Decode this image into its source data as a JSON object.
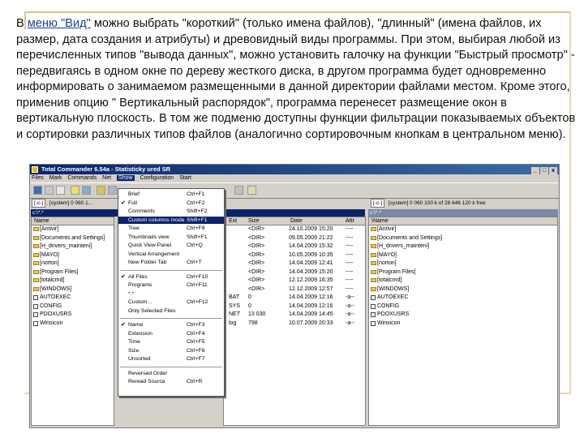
{
  "paragraph": {
    "lead": "В ",
    "link": "меню \"Вид\"",
    "rest": " можно выбрать \"короткий\" (только имена файлов), \"длинный\" (имена файлов, их размер, дата создания и атрибуты) и древовидный виды программы. При этом, выбирая любой из перечисленных типов \"вывода данных\", можно установить галочку на функции \"Быстрый просмотр\" - передвигаясь в одном окне по дереву жесткого диска, в другом программа будет одновременно информировать о занимаемом размещенными в данной директории файлами местом. Кроме этого, применив опцию \" Вертикальный распорядок\", программа перенесет размещение окон в вертикальную плоскость. В том же подменю доступны функции фильтрации показываемых объектов и сортировки различных типов файлов (аналогично сортировочным кнопкам в центральном меню)."
  },
  "window": {
    "title": "Total Commander 6.54a - Statisticky ured SR",
    "buttons": [
      "_",
      "□",
      "x"
    ]
  },
  "menubar": [
    "Files",
    "Mark",
    "Commands",
    "Net",
    "Show",
    "Configuration",
    "Start"
  ],
  "active_menu_index": 4,
  "left_drive": {
    "drive": "[-c-]",
    "volume": "[system]",
    "free": "0 060 1..."
  },
  "right_drive": {
    "drive": "[-c-]",
    "volume": "[system]",
    "free": "0 060 100 k of 28 646 120 k free"
  },
  "left_path": "c:\\*.*",
  "right_path": "c:\\*.*",
  "left_headers": {
    "name": "Name"
  },
  "mid_headers": {
    "ext": "Ext",
    "size": "Size",
    "date": "Date",
    "attr": "Attr"
  },
  "right_headers": {
    "name": "\\Name"
  },
  "left_files": [
    {
      "name": "[Antivir]",
      "folder": true
    },
    {
      "name": "[Documents and Settings]",
      "folder": true
    },
    {
      "name": "[H_drivers_mainteni]",
      "folder": true
    },
    {
      "name": "[MAYO]",
      "folder": true
    },
    {
      "name": "[norton]",
      "folder": true
    },
    {
      "name": "[Program Files]",
      "folder": true
    },
    {
      "name": "[totalcmd]",
      "folder": true
    },
    {
      "name": "[WINDOWS]",
      "folder": true
    },
    {
      "name": "AUTOEXEC",
      "folder": false
    },
    {
      "name": "CONFIG",
      "folder": false
    },
    {
      "name": "PDOXUSRS",
      "folder": false
    },
    {
      "name": "Winsicon",
      "folder": false
    }
  ],
  "mid_rows": [
    {
      "ext": "",
      "size": "<DIR>",
      "date": "24.10.2009 15:20",
      "attr": "----"
    },
    {
      "ext": "",
      "size": "<DIR>",
      "date": "09.05.2009 21:22",
      "attr": "----"
    },
    {
      "ext": "",
      "size": "<DIR>",
      "date": "14.04.2009 15:32",
      "attr": "----"
    },
    {
      "ext": "",
      "size": "<DIR>",
      "date": "10.05.2009 10:35",
      "attr": "----"
    },
    {
      "ext": "",
      "size": "<DIR>",
      "date": "14.04.2009 12:41",
      "attr": "----"
    },
    {
      "ext": "",
      "size": "<DIR>",
      "date": "14.04.2009 15:20",
      "attr": "----"
    },
    {
      "ext": "",
      "size": "<DIR>",
      "date": "12.12.2009 16:35",
      "attr": "----"
    },
    {
      "ext": "",
      "size": "<DIR>",
      "date": "12.12.2009 12:57",
      "attr": "----"
    },
    {
      "ext": "BAT",
      "size": "0",
      "date": "14.04.2009 12:16",
      "attr": "-a--"
    },
    {
      "ext": "SYS",
      "size": "0",
      "date": "14.04.2009 12:16",
      "attr": "-a--"
    },
    {
      "ext": "NET",
      "size": "13 030",
      "date": "14.04.2009 14:45",
      "attr": "-a--"
    },
    {
      "ext": "log",
      "size": "798",
      "date": "10.07.2009 20:33",
      "attr": "-a--"
    }
  ],
  "right_files": [
    {
      "name": "[Antivir]",
      "folder": true
    },
    {
      "name": "[Documents and Settings]",
      "folder": true
    },
    {
      "name": "[H_drivers_mainteni]",
      "folder": true
    },
    {
      "name": "[MAYO]",
      "folder": true
    },
    {
      "name": "[norton]",
      "folder": true
    },
    {
      "name": "[Program Files]",
      "folder": true
    },
    {
      "name": "[totalcmd]",
      "folder": true
    },
    {
      "name": "[WINDOWS]",
      "folder": true
    },
    {
      "name": "AUTOEXEC",
      "folder": false
    },
    {
      "name": "CONFIG",
      "folder": false
    },
    {
      "name": "PDOXUSRS",
      "folder": false
    },
    {
      "name": "Winsicon",
      "folder": false
    }
  ],
  "show_menu": [
    {
      "label": "Brief",
      "shortcut": "Ctrl+F1",
      "checked": false
    },
    {
      "label": "Full",
      "shortcut": "Ctrl+F2",
      "checked": true
    },
    {
      "label": "Comments",
      "shortcut": "Shift+F2",
      "checked": false
    },
    {
      "label": "Custom columns mode",
      "shortcut": "Shift+F1",
      "checked": false,
      "highlighted": true
    },
    {
      "label": "Tree",
      "shortcut": "Ctrl+F8",
      "checked": false
    },
    {
      "label": "Thumbnails view",
      "shortcut": "Shift+F1",
      "checked": false
    },
    {
      "label": "Quick View Panel",
      "shortcut": "Ctrl+Q",
      "checked": false
    },
    {
      "label": "Vertical Arrangement",
      "shortcut": "",
      "checked": false
    },
    {
      "label": "New Folder Tab",
      "shortcut": "Ctrl+T",
      "checked": false
    },
    {
      "separator": true
    },
    {
      "label": "All Files",
      "shortcut": "Ctrl+F10",
      "checked": true
    },
    {
      "label": "Programs",
      "shortcut": "Ctrl+F11",
      "checked": false
    },
    {
      "label": "*.*",
      "shortcut": "",
      "checked": false
    },
    {
      "label": "Custom...",
      "shortcut": "Ctrl+F12",
      "checked": false
    },
    {
      "label": "Only Selected Files",
      "shortcut": "",
      "checked": false
    },
    {
      "separator": true
    },
    {
      "label": "Name",
      "shortcut": "Ctrl+F3",
      "checked": true
    },
    {
      "label": "Extension",
      "shortcut": "Ctrl+F4",
      "checked": false
    },
    {
      "label": "Time",
      "shortcut": "Ctrl+F5",
      "checked": false
    },
    {
      "label": "Size",
      "shortcut": "Ctrl+F6",
      "checked": false
    },
    {
      "label": "Unsorted",
      "shortcut": "Ctrl+F7",
      "checked": false
    },
    {
      "separator": true
    },
    {
      "label": "Reversed Order",
      "shortcut": "",
      "checked": false
    },
    {
      "label": "Reread Source",
      "shortcut": "Ctrl+R",
      "checked": false
    }
  ]
}
